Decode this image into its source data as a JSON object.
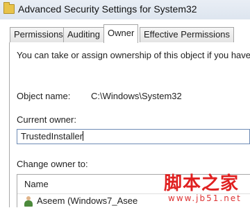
{
  "window": {
    "title": "Advanced Security Settings for System32",
    "icon": "folder-icon"
  },
  "tabs": [
    {
      "label": "Permissions",
      "active": false
    },
    {
      "label": "Auditing",
      "active": false
    },
    {
      "label": "Owner",
      "active": true
    },
    {
      "label": "Effective Permissions",
      "active": false
    }
  ],
  "owner_tab": {
    "intro": "You can take or assign ownership of this object if you have",
    "object_name_label": "Object name:",
    "object_name_value": "C:\\Windows\\System32",
    "current_owner_label": "Current owner:",
    "current_owner_value": "TrustedInstaller",
    "change_owner_label": "Change owner to:",
    "list": {
      "column_header": "Name",
      "rows": [
        {
          "name": "Aseem (Windows7_Asee",
          "icon": "user-icon"
        }
      ]
    }
  },
  "watermark": {
    "text": "脚本之家",
    "url": "www.jb51.net"
  }
}
